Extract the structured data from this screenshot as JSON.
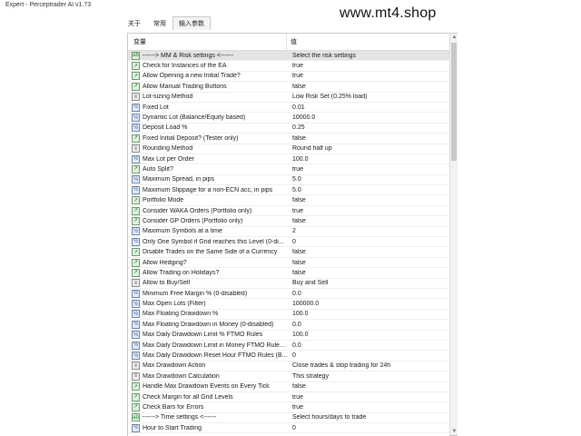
{
  "window": {
    "title": "Expert - Perceptrader AI v1.73"
  },
  "watermark": "www.mt4.shop",
  "tabs": [
    {
      "label": "关于"
    },
    {
      "label": "常用"
    },
    {
      "label": "输入参数"
    }
  ],
  "table": {
    "headers": {
      "variable": "变量",
      "value": "值"
    },
    "rows": [
      {
        "name": "------> MM & Risk settings <------",
        "value": "Select the risk settings",
        "icon": "text-param-icon"
      },
      {
        "name": "Check for Instances of the EA",
        "value": "true",
        "icon": "bool-param-icon"
      },
      {
        "name": "Allow Opening a new Initial Trade?",
        "value": "true",
        "icon": "bool-param-icon"
      },
      {
        "name": "Allow Manual Trading Buttons",
        "value": "false",
        "icon": "bool-param-icon"
      },
      {
        "name": "Lot-sizing Method",
        "value": "Low Risk Set (0.25% load)",
        "icon": "enum-param-icon"
      },
      {
        "name": "Fixed Lot",
        "value": "0.01",
        "icon": "number-param-icon"
      },
      {
        "name": "Dynamic Lot (Balance/Equity based)",
        "value": "10000.0",
        "icon": "number-param-icon"
      },
      {
        "name": "Deposit Load %",
        "value": "0.25",
        "icon": "number-param-icon"
      },
      {
        "name": "Fixed Initial Deposit? (Tester only)",
        "value": "false",
        "icon": "bool-param-icon"
      },
      {
        "name": "Rounding Method",
        "value": "Round half up",
        "icon": "enum-param-icon"
      },
      {
        "name": "Max Lot per Order",
        "value": "100.0",
        "icon": "number-param-icon"
      },
      {
        "name": "Auto Split?",
        "value": "true",
        "icon": "bool-param-icon"
      },
      {
        "name": "Maximum Spread, in pips",
        "value": "5.0",
        "icon": "number-param-icon"
      },
      {
        "name": "Maximum Slippage for a non-ECN acc, in pips",
        "value": "5.0",
        "icon": "number-param-icon"
      },
      {
        "name": "Portfolio Mode",
        "value": "false",
        "icon": "bool-param-icon"
      },
      {
        "name": "Consider WAKA Orders (Portfolio only)",
        "value": "true",
        "icon": "bool-param-icon"
      },
      {
        "name": "Consider GP Orders (Portfolio only)",
        "value": "false",
        "icon": "bool-param-icon"
      },
      {
        "name": "Maximum Symbols at a time",
        "value": "2",
        "icon": "number-param-icon"
      },
      {
        "name": "Only One Symbol if Grid reaches this Level (0-di...",
        "value": "0",
        "icon": "number-param-icon"
      },
      {
        "name": "Disable Trades on the Same Side of a Currency",
        "value": "false",
        "icon": "bool-param-icon"
      },
      {
        "name": "Allow Hedging?",
        "value": "false",
        "icon": "bool-param-icon"
      },
      {
        "name": "Allow Trading on Holidays?",
        "value": "false",
        "icon": "bool-param-icon"
      },
      {
        "name": "Allow to Buy/Sell",
        "value": "Buy and Sell",
        "icon": "enum-param-icon"
      },
      {
        "name": "Minimum Free Margin % (0-disabled)",
        "value": "0.0",
        "icon": "number-param-icon"
      },
      {
        "name": "Max Open Lots (Filter)",
        "value": "100000.0",
        "icon": "number-param-icon"
      },
      {
        "name": "Max Floating Drawdown %",
        "value": "100.0",
        "icon": "number-param-icon"
      },
      {
        "name": "Max Floating Drawdown in Money (0-disabled)",
        "value": "0.0",
        "icon": "number-param-icon"
      },
      {
        "name": "Max Daily Drawdown Limit % FTMO Rules",
        "value": "100.0",
        "icon": "number-param-icon"
      },
      {
        "name": "Max Daily Drawdown Limit in Money FTMO Rule...",
        "value": "0.0",
        "icon": "number-param-icon"
      },
      {
        "name": "Max Daily Drawdown Reset Hour FTMO Rules (B...",
        "value": "0",
        "icon": "number-param-icon"
      },
      {
        "name": "Max Drawdown Action",
        "value": "Close trades & stop trading for 24h",
        "icon": "enum-param-icon"
      },
      {
        "name": "Max Drawdown Calculation",
        "value": "This strategy",
        "icon": "enum-param-icon"
      },
      {
        "name": "Handle Max Drawdown Events on Every Tick",
        "value": "false",
        "icon": "bool-param-icon"
      },
      {
        "name": "Check Margin for all Grid Levels",
        "value": "true",
        "icon": "bool-param-icon"
      },
      {
        "name": "Check Bars for Errors",
        "value": "true",
        "icon": "bool-param-icon"
      },
      {
        "name": "------> Time settings <------",
        "value": "Select hours/days to trade",
        "icon": "text-param-icon"
      },
      {
        "name": "Hour to Start Trading",
        "value": "0",
        "icon": "number-param-icon"
      }
    ]
  },
  "scrollbar": {
    "position_fraction": 0.0
  }
}
